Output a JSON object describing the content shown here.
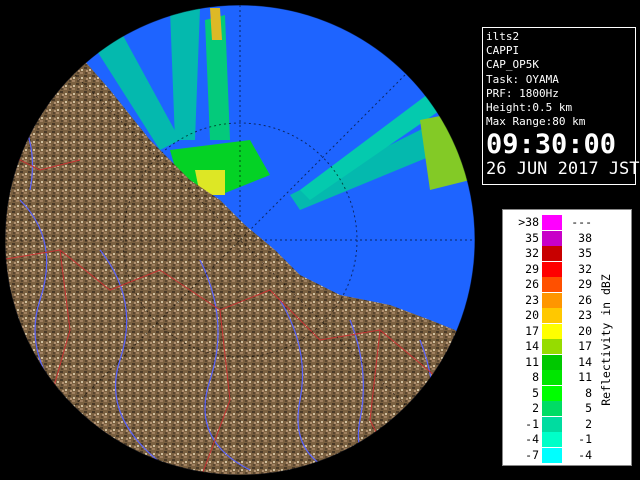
{
  "info": {
    "site": "ilts2",
    "product": "CAPPI",
    "product_code": "CAP_OP5K",
    "task": "Task: OYAMA",
    "prf": "PRF: 1800Hz",
    "height": "Height:0.5 km",
    "max_range": "Max Range:80 km",
    "time": "09:30:00",
    "date": "26 JUN 2017 JST"
  },
  "legend": {
    "title": "Reflectivity in dBZ",
    "rows": [
      {
        "lo": ">38",
        "hi": "---",
        "color": "#ff00ff"
      },
      {
        "lo": "35",
        "hi": "38",
        "color": "#c800c8"
      },
      {
        "lo": "32",
        "hi": "35",
        "color": "#c80000"
      },
      {
        "lo": "29",
        "hi": "32",
        "color": "#ff0000"
      },
      {
        "lo": "26",
        "hi": "29",
        "color": "#ff5000"
      },
      {
        "lo": "23",
        "hi": "26",
        "color": "#ff9600"
      },
      {
        "lo": "20",
        "hi": "23",
        "color": "#ffc800"
      },
      {
        "lo": "17",
        "hi": "20",
        "color": "#ffff00"
      },
      {
        "lo": "14",
        "hi": "17",
        "color": "#96dc00"
      },
      {
        "lo": "11",
        "hi": "14",
        "color": "#00c800"
      },
      {
        "lo": "8",
        "hi": "11",
        "color": "#00e600"
      },
      {
        "lo": "5",
        "hi": "8",
        "color": "#00ff00"
      },
      {
        "lo": "2",
        "hi": "5",
        "color": "#00dc64"
      },
      {
        "lo": "-1",
        "hi": "2",
        "color": "#00dca0"
      },
      {
        "lo": "-4",
        "hi": "-1",
        "color": "#00ffc8"
      },
      {
        "lo": "-7",
        "hi": "-4",
        "color": "#00ffff"
      }
    ]
  },
  "colors": {
    "sea": "#1e64ff",
    "land": "#7a6040",
    "outside": "#000000",
    "rivers": "#5a64ff",
    "boundaries": "#c83232"
  }
}
